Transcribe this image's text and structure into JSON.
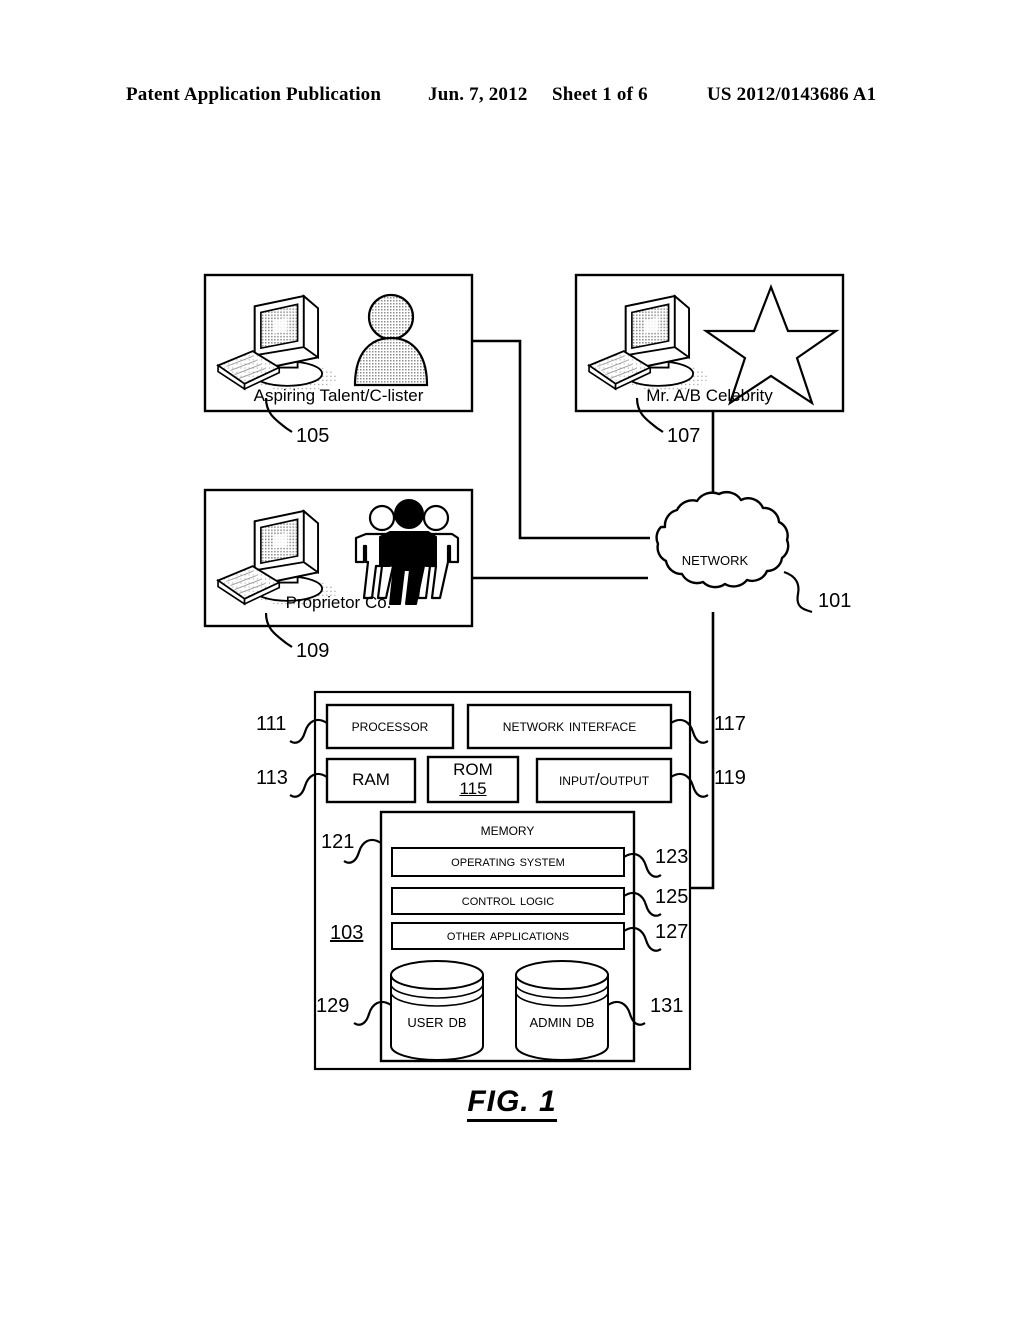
{
  "header": {
    "publication": "Patent Application Publication",
    "date": "Jun. 7, 2012",
    "sheet": "Sheet 1 of 6",
    "number": "US 2012/0143686 A1"
  },
  "figure": {
    "caption": "FIG. 1",
    "network": {
      "label": "Network",
      "ref": "101"
    },
    "terminals": [
      {
        "id": "aspiring-talent",
        "label": "Aspiring Talent/C-lister",
        "ref": "105",
        "icon": "person-avatar-icon"
      },
      {
        "id": "celebrity",
        "label": "Mr. A/B Celebrity",
        "ref": "107",
        "icon": "star-icon"
      },
      {
        "id": "proprietor",
        "label": "Proprietor Co.",
        "ref": "109",
        "icon": "three-people-icon"
      }
    ],
    "computing_device": {
      "ref": "103",
      "components": [
        {
          "id": "processor",
          "label": "Processor",
          "ref": "111"
        },
        {
          "id": "network-interface",
          "label": "Network interface",
          "ref": "117"
        },
        {
          "id": "ram",
          "label": "RAM",
          "ref": "113"
        },
        {
          "id": "rom",
          "label": "ROM",
          "ref": "115"
        },
        {
          "id": "input-output",
          "label": "Input/output",
          "ref": "119"
        }
      ],
      "memory": {
        "label": "Memory",
        "ref": "121",
        "items": [
          {
            "id": "operating-system",
            "label": "Operating system",
            "ref": "123"
          },
          {
            "id": "control-logic",
            "label": "Control logic",
            "ref": "125"
          },
          {
            "id": "other-applications",
            "label": "Other applications",
            "ref": "127"
          }
        ],
        "databases": [
          {
            "id": "user-db",
            "label": "User DB",
            "ref": "129"
          },
          {
            "id": "admin-db",
            "label": "Admin DB",
            "ref": "131"
          }
        ]
      }
    }
  },
  "colors": {
    "ink": "#000000",
    "paper": "#ffffff",
    "shade": "#b8b8b8",
    "shade_light": "#d8d8d8"
  }
}
